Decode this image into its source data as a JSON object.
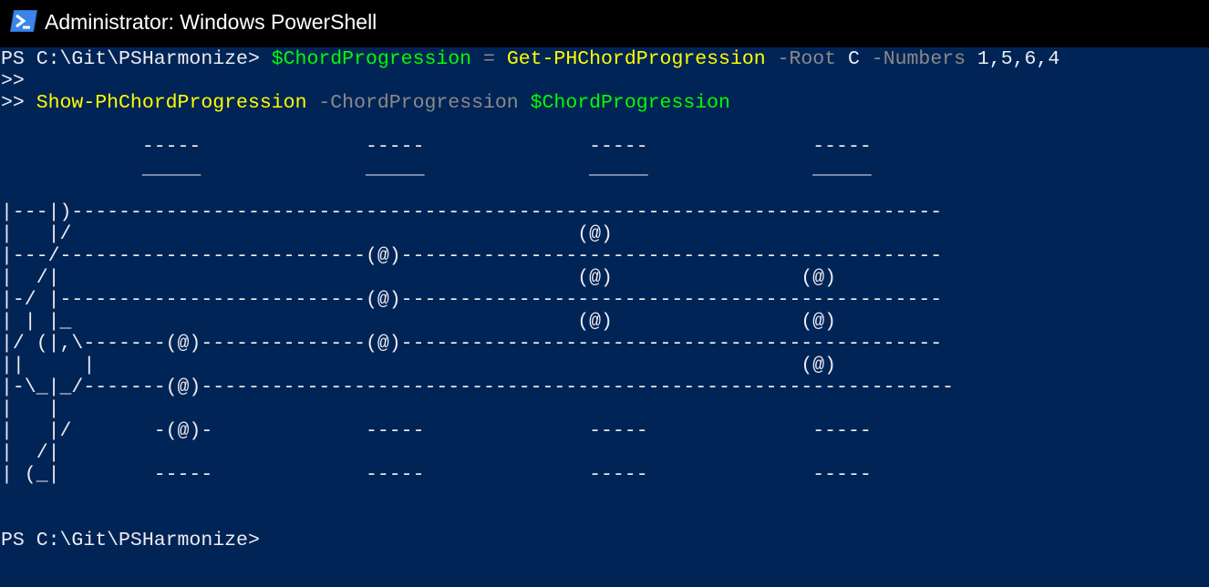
{
  "window": {
    "title": "Administrator: Windows PowerShell",
    "icon": "powershell-icon",
    "colors": {
      "background": "#012456",
      "titlebar": "#000000",
      "text": "#eeedf0",
      "variable": "#00ff00",
      "command": "#ffff00",
      "parameter": "#8a8a8a"
    }
  },
  "console": {
    "cmd1": {
      "prompt": "PS C:\\Git\\PSHarmonize> ",
      "variable": "$ChordProgression",
      "equals": " = ",
      "command": "Get-PHChordProgression",
      "param1": " -Root",
      "root_value": " C",
      "param2": " -Numbers",
      "numbers_value": " 1,5,6,4"
    },
    "continuation": ">>",
    "cmd2": {
      "prompt": ">> ",
      "command": "Show-PhChordProgression",
      "param": " -ChordProgression",
      "variable": " $ChordProgression"
    },
    "staff_lines": [
      "            -----              -----              -----              -----",
      "            _____              _____              _____              _____",
      "",
      "|---|)--------------------------------------------------------------------------",
      "|   |/                                           (@)",
      "|---/--------------------------(@)----------------------------------------------",
      "|  /|                                            (@)                (@)",
      "|-/ |--------------------------(@)----------------------------------------------",
      "| | |_                                           (@)                (@)",
      "|/ (|,\\-------(@)--------------(@)----------------------------------------------",
      "||     |                                                            (@)",
      "|-\\_|_/-------(@)----------------------------------------------------------------",
      "|   |",
      "|   |/       -(@)-             -----              -----              -----",
      "|  /|",
      "| (_|        -----             -----              -----              -----"
    ],
    "final_prompt": "PS C:\\Git\\PSHarmonize>"
  }
}
